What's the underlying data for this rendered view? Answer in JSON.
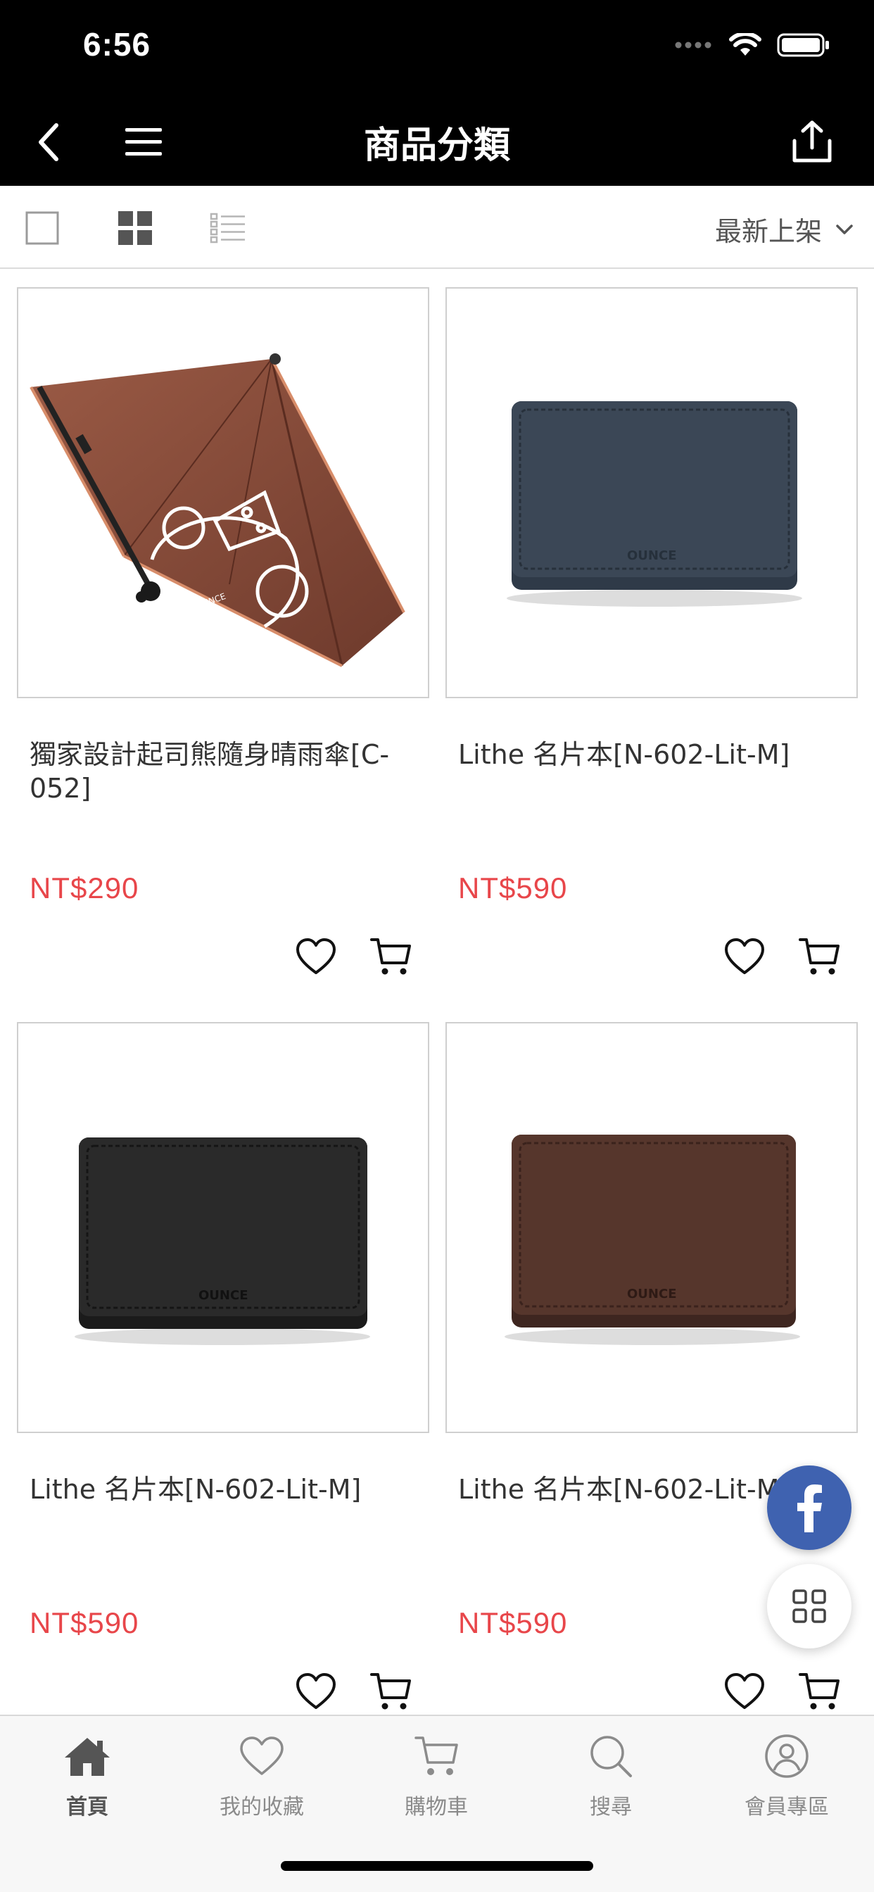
{
  "status": {
    "time": "6:56"
  },
  "nav": {
    "title": "商品分類"
  },
  "toolbar": {
    "sort_label": "最新上架"
  },
  "products": [
    {
      "title": "獨家設計起司熊隨身晴雨傘[C-052]",
      "price": "NT$290",
      "image": "umbrella-image"
    },
    {
      "title": "Lithe 名片本[N-602-Lit-M]",
      "price": "NT$590",
      "image": "navy-card-case-image"
    },
    {
      "title": "Lithe 名片本[N-602-Lit-M]",
      "price": "NT$590",
      "image": "black-card-case-image"
    },
    {
      "title": "Lithe 名片本[N-602-Lit-M]",
      "price": "NT$590",
      "image": "brown-card-case-image"
    }
  ],
  "product_image_brand": "OUNCE",
  "tabs": [
    {
      "label": "首頁",
      "icon": "home-icon",
      "active": true
    },
    {
      "label": "我的收藏",
      "icon": "heart-icon"
    },
    {
      "label": "購物車",
      "icon": "cart-icon"
    },
    {
      "label": "搜尋",
      "icon": "search-icon"
    },
    {
      "label": "會員專區",
      "icon": "user-icon"
    }
  ],
  "colors": {
    "price": "#e8464a",
    "facebook": "#3f62b0",
    "nav_bg": "#000000"
  }
}
